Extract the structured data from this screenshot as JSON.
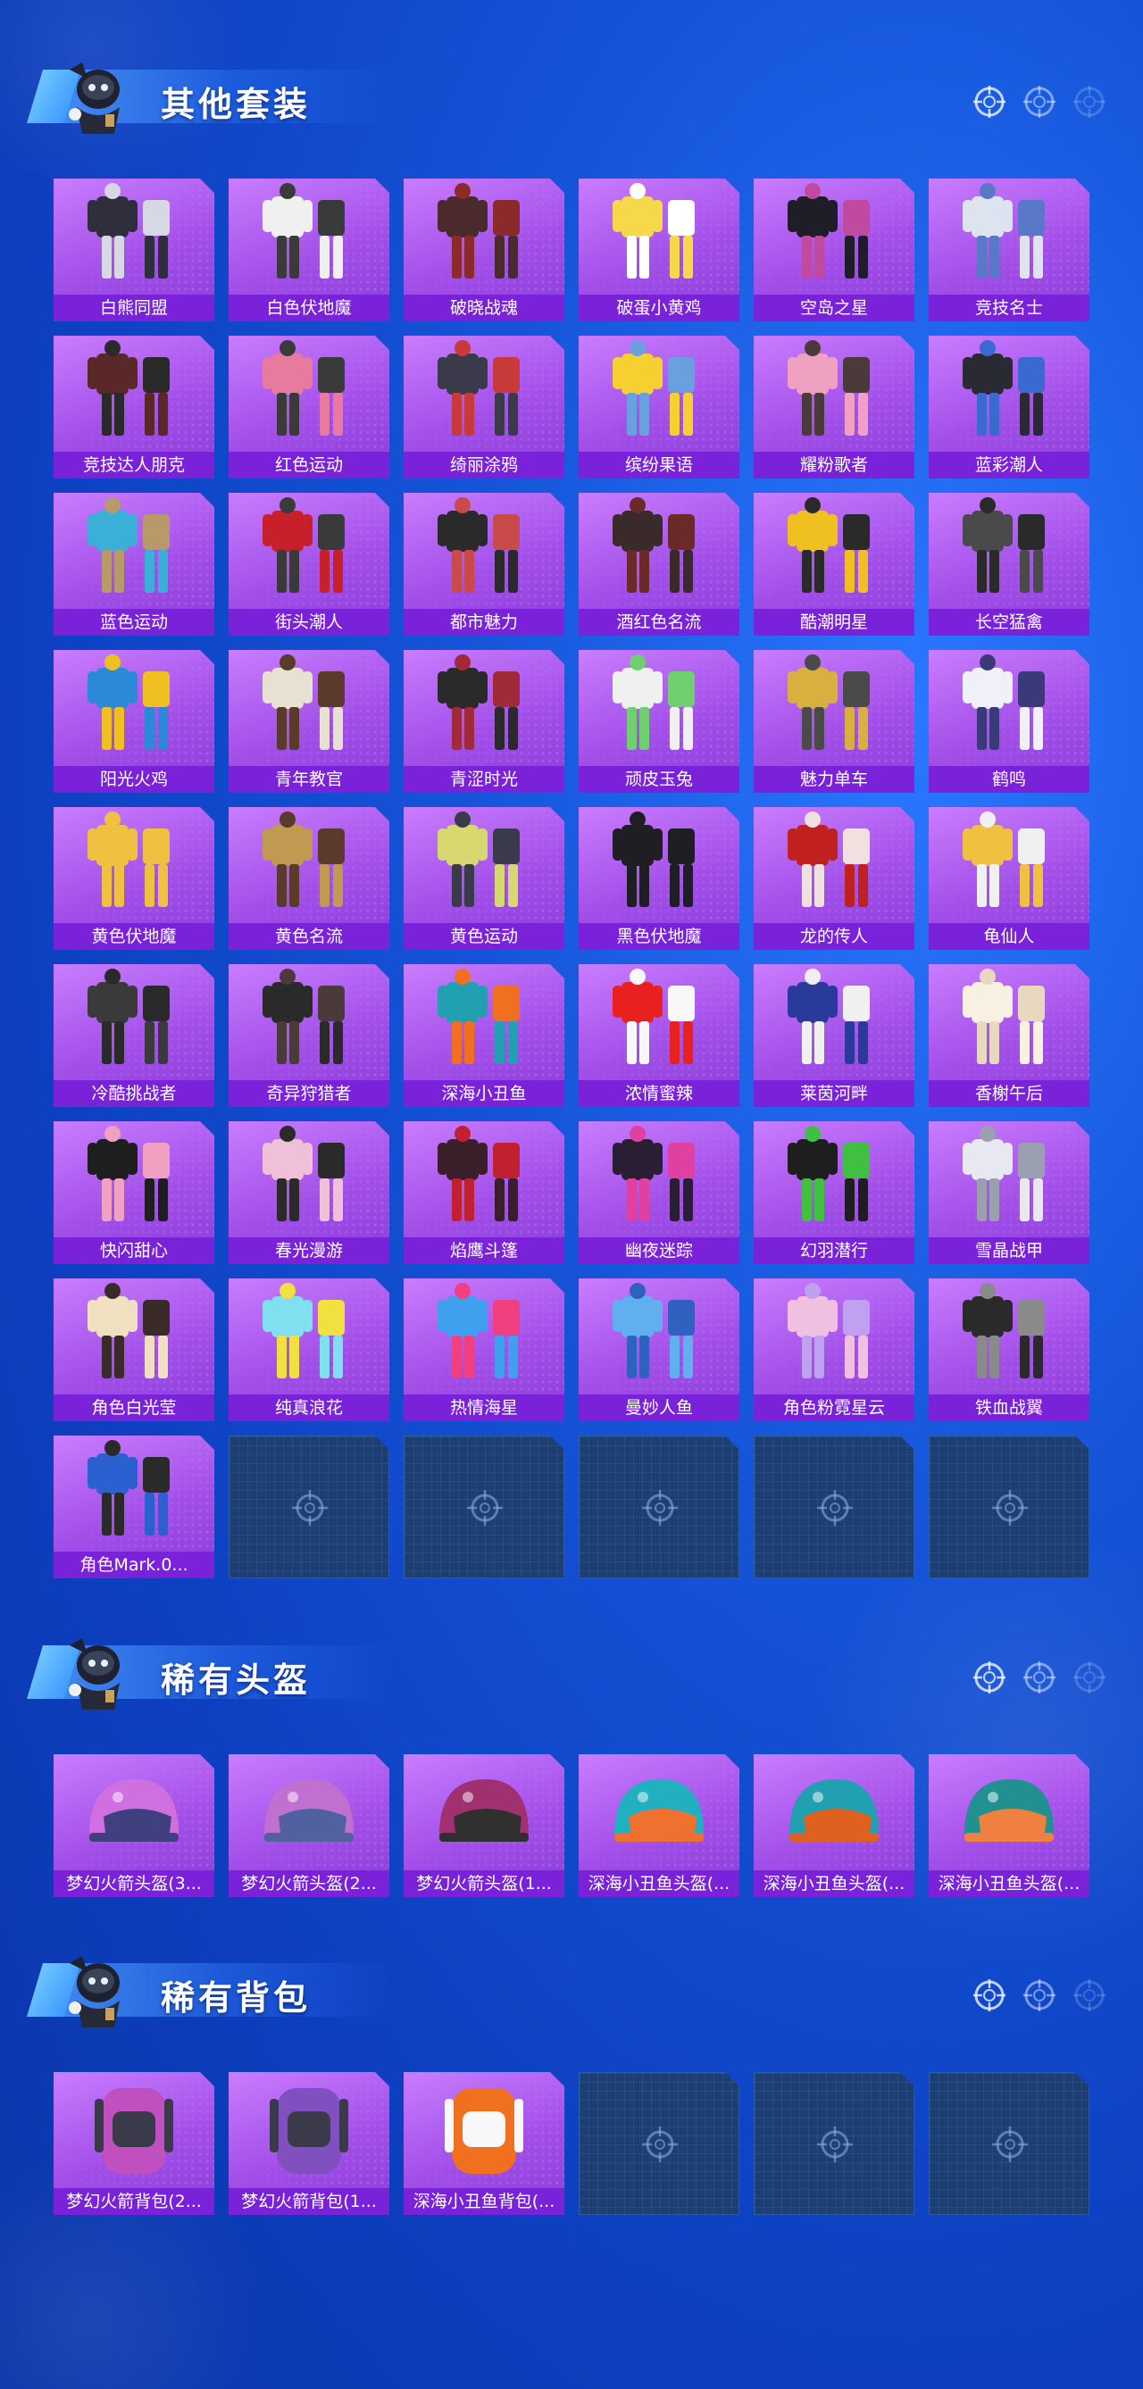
{
  "sections": {
    "suits": {
      "title": "其他套装",
      "items": [
        {
          "label": "白熊同盟",
          "tone": [
            "#2e2e3c",
            "#d8d8e4"
          ]
        },
        {
          "label": "白色伏地魔",
          "tone": [
            "#f0f0f0",
            "#3a3a3a"
          ]
        },
        {
          "label": "破晓战魂",
          "tone": [
            "#4a2a2a",
            "#8a2a2a"
          ]
        },
        {
          "label": "破蛋小黄鸡",
          "tone": [
            "#f6d94a",
            "#ffffff"
          ]
        },
        {
          "label": "空岛之星",
          "tone": [
            "#1e1e28",
            "#c04aa0"
          ]
        },
        {
          "label": "竞技名士",
          "tone": [
            "#dde4f0",
            "#5a78c8"
          ]
        },
        {
          "label": "竞技达人朋克",
          "tone": [
            "#5a2828",
            "#2a2a2a"
          ]
        },
        {
          "label": "红色运动",
          "tone": [
            "#e87aa0",
            "#3a3a3a"
          ]
        },
        {
          "label": "绮丽涂鸦",
          "tone": [
            "#3a3a4a",
            "#c83a3a"
          ]
        },
        {
          "label": "缤纷果语",
          "tone": [
            "#f6d030",
            "#6aa0e0"
          ]
        },
        {
          "label": "耀粉歌者",
          "tone": [
            "#f0a0c0",
            "#4a3a3a"
          ]
        },
        {
          "label": "蓝彩潮人",
          "tone": [
            "#2a2a34",
            "#3a6ad0"
          ]
        },
        {
          "label": "蓝色运动",
          "tone": [
            "#3ab0d8",
            "#b89a6a"
          ]
        },
        {
          "label": "街头潮人",
          "tone": [
            "#c8202a",
            "#3a3a3a"
          ]
        },
        {
          "label": "都市魅力",
          "tone": [
            "#2a2a2a",
            "#c84a4a"
          ]
        },
        {
          "label": "酒红色名流",
          "tone": [
            "#3a2a2a",
            "#6a2a2a"
          ]
        },
        {
          "label": "酷潮明星",
          "tone": [
            "#f0c020",
            "#2a2a2a"
          ]
        },
        {
          "label": "长空猛禽",
          "tone": [
            "#4a4a4a",
            "#2a2a2a"
          ]
        },
        {
          "label": "阳光火鸡",
          "tone": [
            "#2a8ad8",
            "#f0c020"
          ]
        },
        {
          "label": "青年教官",
          "tone": [
            "#e8e0d0",
            "#5a3a2a"
          ]
        },
        {
          "label": "青涩时光",
          "tone": [
            "#2a2a2a",
            "#a02a3a"
          ]
        },
        {
          "label": "顽皮玉兔",
          "tone": [
            "#f0f0f0",
            "#70d070"
          ]
        },
        {
          "label": "魅力单车",
          "tone": [
            "#d8b040",
            "#4a4a4a"
          ]
        },
        {
          "label": "鹤鸣",
          "tone": [
            "#f0f0f8",
            "#3a3a7a"
          ]
        },
        {
          "label": "黄色伏地魔",
          "tone": [
            "#f0c040",
            "#f0c040"
          ]
        },
        {
          "label": "黄色名流",
          "tone": [
            "#c09a50",
            "#5a3a2a"
          ]
        },
        {
          "label": "黄色运动",
          "tone": [
            "#d8d870",
            "#3a3a4a"
          ]
        },
        {
          "label": "黑色伏地魔",
          "tone": [
            "#1e1e24",
            "#1e1e24"
          ]
        },
        {
          "label": "龙的传人",
          "tone": [
            "#c02020",
            "#f0e0e0"
          ]
        },
        {
          "label": "龟仙人",
          "tone": [
            "#f0c040",
            "#f0f0f0"
          ]
        },
        {
          "label": "冷酷挑战者",
          "tone": [
            "#3a3a3a",
            "#2a2a2a"
          ]
        },
        {
          "label": "奇异狩猎者",
          "tone": [
            "#2a2a2a",
            "#4a3a3a"
          ]
        },
        {
          "label": "深海小丑鱼",
          "tone": [
            "#20a0b0",
            "#f07020"
          ]
        },
        {
          "label": "浓情蜜辣",
          "tone": [
            "#e82020",
            "#f8f8f8"
          ]
        },
        {
          "label": "莱茵河畔",
          "tone": [
            "#2a3a9a",
            "#f0f0f0"
          ]
        },
        {
          "label": "香榭午后",
          "tone": [
            "#f8f0e0",
            "#e8d8c0"
          ]
        },
        {
          "label": "快闪甜心",
          "tone": [
            "#1e1e1e",
            "#f0a0c0"
          ]
        },
        {
          "label": "春光漫游",
          "tone": [
            "#f0c0d8",
            "#2a2a2a"
          ]
        },
        {
          "label": "焰鹰斗篷",
          "tone": [
            "#3a1e2a",
            "#c02030"
          ]
        },
        {
          "label": "幽夜迷踪",
          "tone": [
            "#2a1e34",
            "#e040a0"
          ]
        },
        {
          "label": "幻羽潜行",
          "tone": [
            "#1e1e1e",
            "#40c040"
          ]
        },
        {
          "label": "雪晶战甲",
          "tone": [
            "#e8e8f0",
            "#9aa0b0"
          ]
        },
        {
          "label": "角色白光莹",
          "tone": [
            "#f0e0c0",
            "#3a2a2a"
          ]
        },
        {
          "label": "纯真浪花",
          "tone": [
            "#80e0f0",
            "#f0e040"
          ]
        },
        {
          "label": "热情海星",
          "tone": [
            "#40a0f0",
            "#f04080"
          ]
        },
        {
          "label": "曼妙人鱼",
          "tone": [
            "#60b0f0",
            "#3060c0"
          ]
        },
        {
          "label": "角色粉霓星云",
          "tone": [
            "#f0c0e0",
            "#c0a0f0"
          ]
        },
        {
          "label": "铁血战翼",
          "tone": [
            "#2a2a2a",
            "#8a8a8a"
          ]
        },
        {
          "label": "角色Mark.0...",
          "tone": [
            "#2a60d0",
            "#2a2a2a"
          ]
        }
      ]
    },
    "helmets": {
      "title": "稀有头盔",
      "items": [
        {
          "label": "梦幻火箭头盔(3...",
          "tone": [
            "#d070e0",
            "#404080"
          ]
        },
        {
          "label": "梦幻火箭头盔(2...",
          "tone": [
            "#c070d0",
            "#5060a0"
          ]
        },
        {
          "label": "梦幻火箭头盔(1...",
          "tone": [
            "#a03070",
            "#303030"
          ]
        },
        {
          "label": "深海小丑鱼头盔(...",
          "tone": [
            "#20b0c0",
            "#f07030"
          ]
        },
        {
          "label": "深海小丑鱼头盔(...",
          "tone": [
            "#20a0b0",
            "#e06020"
          ]
        },
        {
          "label": "深海小丑鱼头盔(...",
          "tone": [
            "#209090",
            "#f08040"
          ]
        }
      ]
    },
    "backpacks": {
      "title": "稀有背包",
      "items": [
        {
          "label": "梦幻火箭背包(2...",
          "tone": [
            "#c050c0",
            "#3a3a4a"
          ]
        },
        {
          "label": "梦幻火箭背包(1...",
          "tone": [
            "#8050c0",
            "#3a3a4a"
          ]
        },
        {
          "label": "深海小丑鱼背包(...",
          "tone": [
            "#f07020",
            "#f8f8f8"
          ]
        }
      ]
    }
  }
}
